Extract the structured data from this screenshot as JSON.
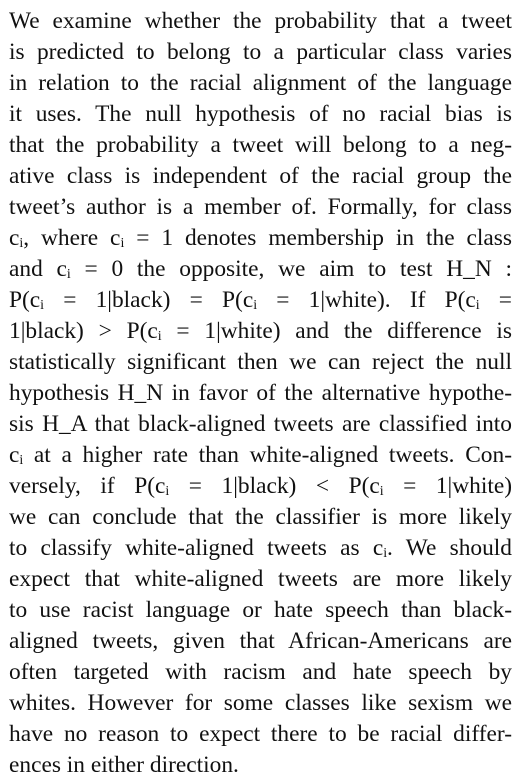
{
  "paragraph": {
    "lines": [
      "We examine whether the probability that a tweet",
      "is predicted to belong to a particular class varies",
      "in relation to the racial alignment of the language",
      "it uses.  The null hypothesis of no racial bias is",
      "that the probability a tweet will belong to a neg-",
      "ative class is independent of the racial group the",
      "tweet’s author is a member of. Formally, for class",
      "cᵢ, where cᵢ = 1 denotes membership in the class",
      "and cᵢ = 0 the opposite, we aim to test H_N :",
      "P(cᵢ = 1|black) = P(cᵢ = 1|white). If P(cᵢ =",
      "1|black) > P(cᵢ = 1|white) and the difference is",
      "statistically significant then we can reject the null",
      "hypothesis H_N in favor of the alternative hypothe-",
      "sis H_A that black-aligned tweets are classified into",
      "cᵢ at a higher rate than white-aligned tweets. Con-",
      "versely, if P(cᵢ = 1|black) < P(cᵢ = 1|white)",
      "we can conclude that the classifier is more likely",
      "to classify white-aligned tweets as cᵢ. We should",
      "expect that white-aligned tweets are more likely",
      "to use racist language or hate speech than black-",
      "aligned tweets, given that African-Americans are",
      "often targeted with racism and hate speech by",
      "whites. However for some classes like sexism we",
      "have no reason to expect there to be racial differ-",
      "ences in either direction."
    ]
  }
}
